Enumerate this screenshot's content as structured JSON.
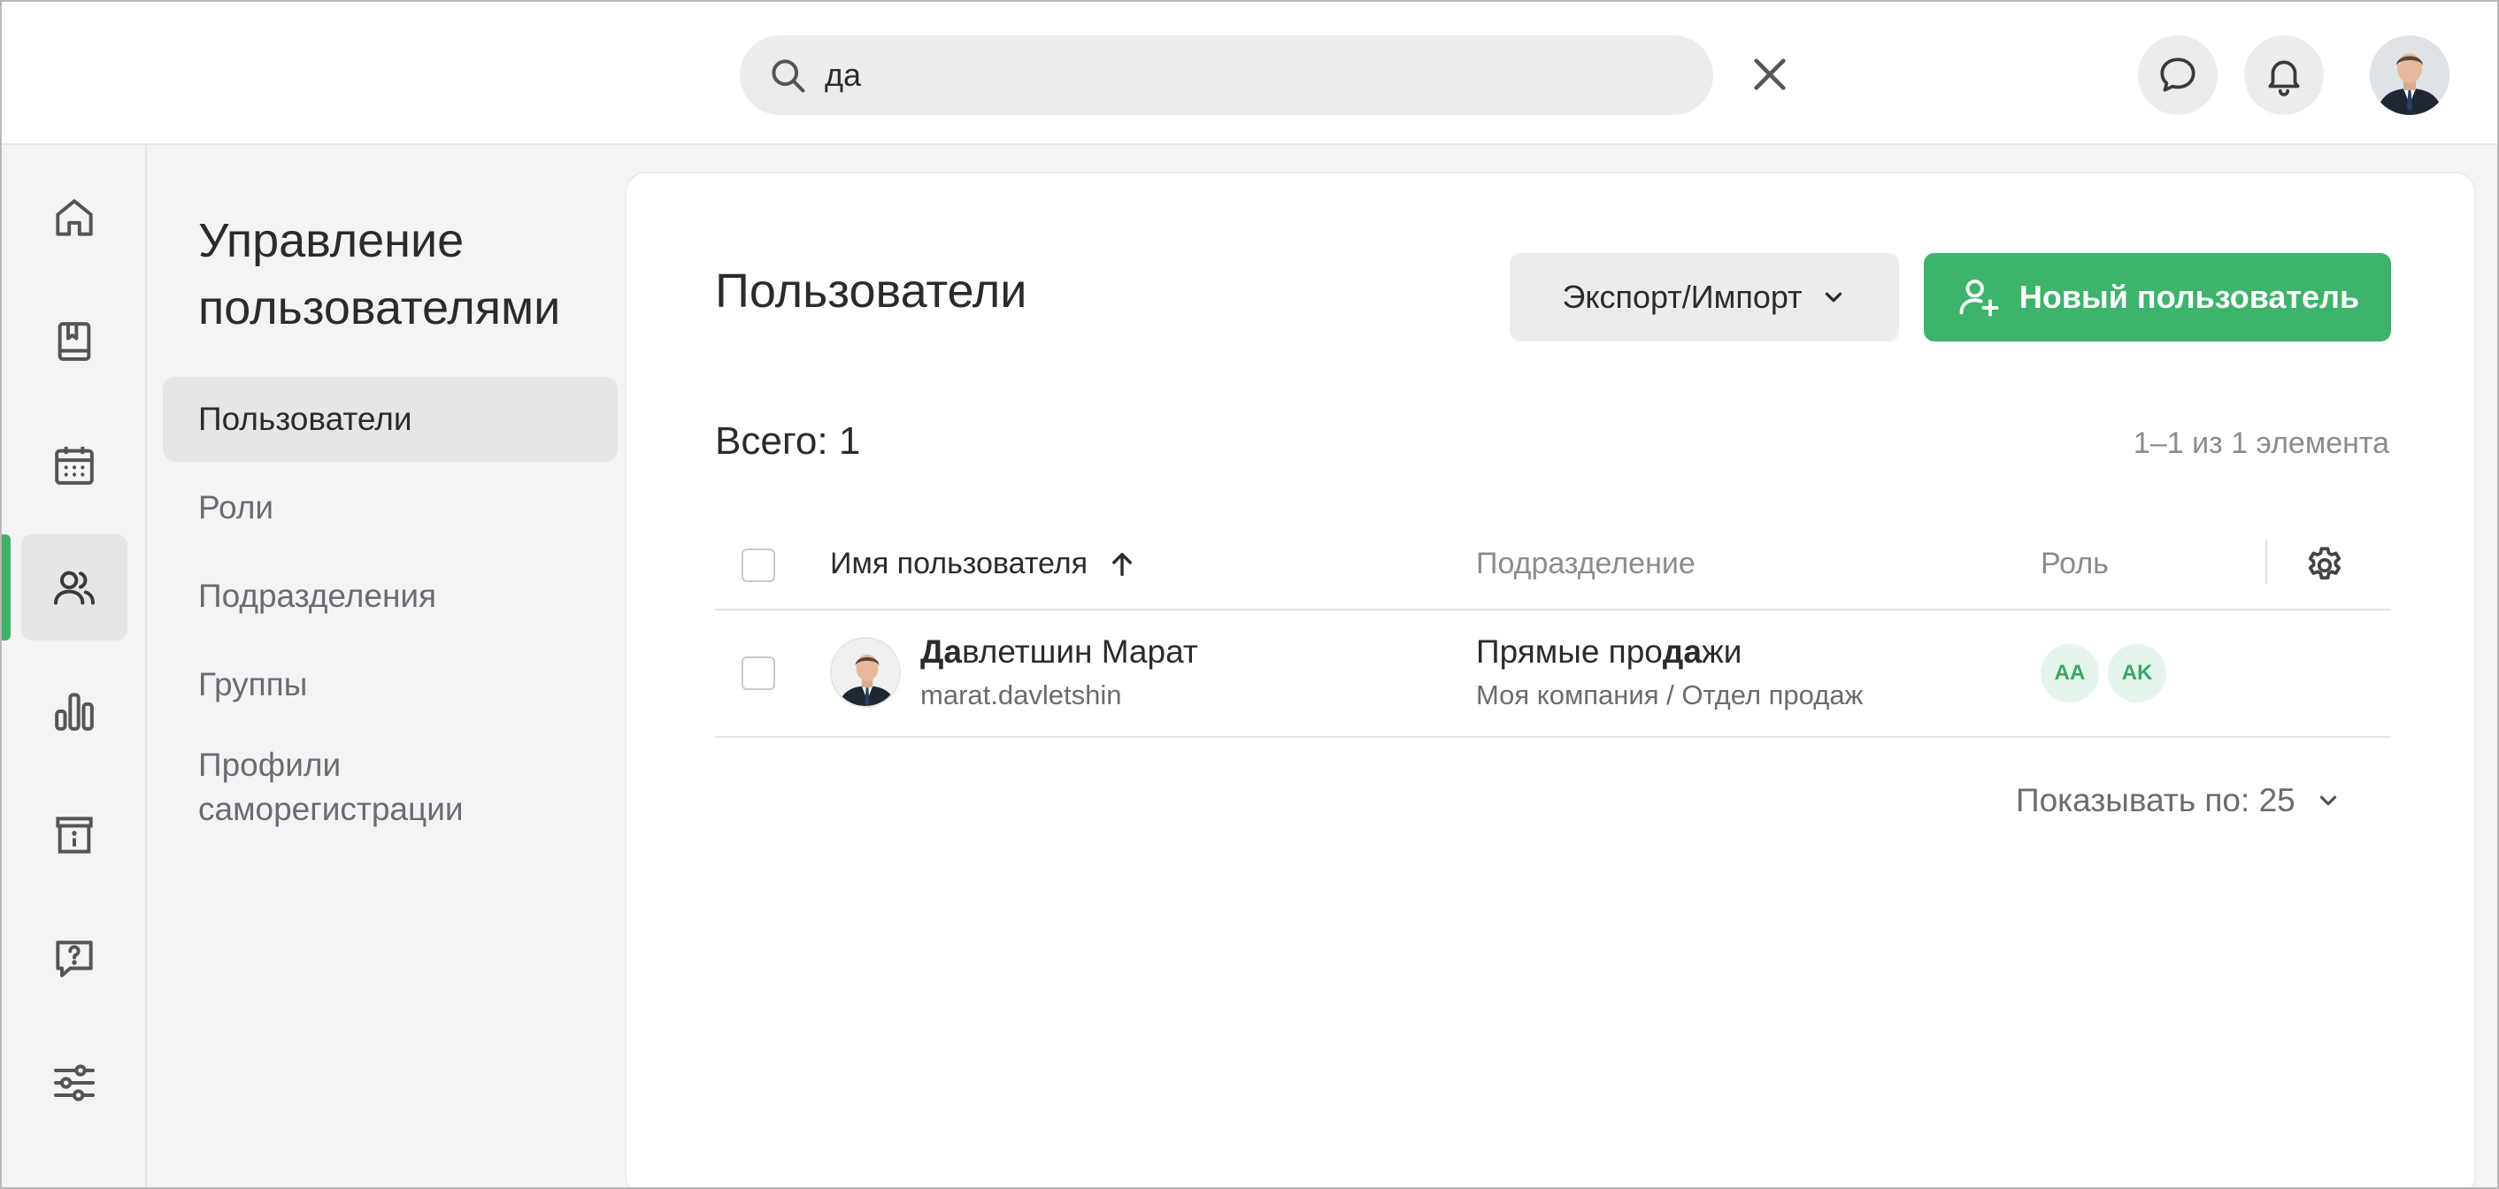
{
  "search": {
    "value": "да"
  },
  "avatar": {
    "alt": "Давлетшин Марат"
  },
  "rail": {
    "items": [
      "home",
      "book",
      "calendar",
      "users",
      "analytics",
      "info",
      "help",
      "settings"
    ],
    "active": "users"
  },
  "subnav": {
    "title_line1": "Управление",
    "title_line2": "пользователями",
    "items": [
      {
        "label": "Пользователи",
        "active": true
      },
      {
        "label": "Роли"
      },
      {
        "label": "Подразделения"
      },
      {
        "label": "Группы"
      },
      {
        "label_line1": "Профили",
        "label_line2": "саморегистрации"
      }
    ]
  },
  "page": {
    "title": "Пользователи",
    "export_label": "Экспорт/Импорт",
    "new_user_label": "Новый пользователь",
    "total_label": "Всего: 1",
    "range_label": "1–1 из 1 элемента"
  },
  "table": {
    "columns": {
      "name": "Имя пользователя",
      "department": "Подразделение",
      "role": "Роль"
    },
    "rows": [
      {
        "name_highlight": "Да",
        "name_rest": "влетшин Марат",
        "login": "marat.davletshin",
        "dept_pre": "Прямые про",
        "dept_highlight": "да",
        "dept_post": "жи",
        "dept_path": "Моя компания / Отдел продаж",
        "roles": [
          "AA",
          "AK"
        ]
      }
    ]
  },
  "pagination": {
    "label": "Показывать по: 25"
  },
  "colors": {
    "accent": "#3db36b",
    "badge_bg": "#e6f5ec",
    "badge_text": "#3aa865"
  }
}
